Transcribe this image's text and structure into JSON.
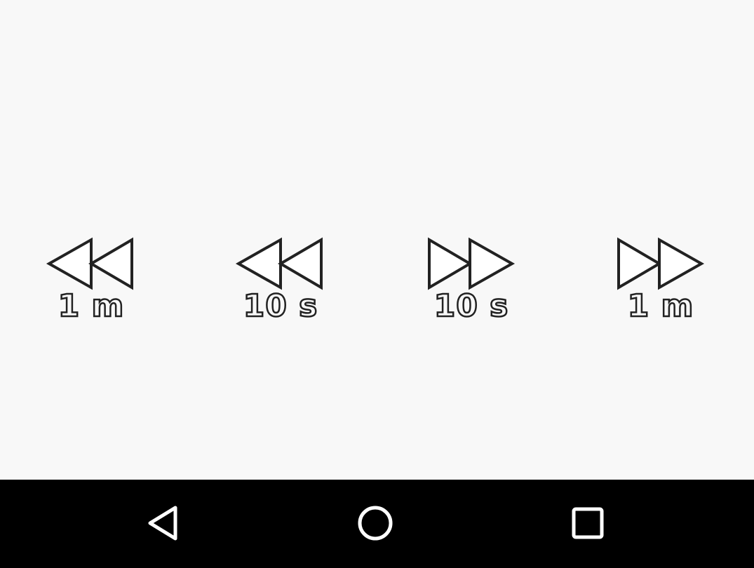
{
  "player_controls": {
    "rewind_1m": {
      "label": "1 m",
      "icon": "rewind-icon"
    },
    "rewind_10s": {
      "label": "10 s",
      "icon": "rewind-icon"
    },
    "forward_10s": {
      "label": "10 s",
      "icon": "fast-forward-icon"
    },
    "forward_1m": {
      "label": "1 m",
      "icon": "fast-forward-icon"
    }
  },
  "navigation_bar": {
    "buttons": [
      {
        "name": "back",
        "icon": "back-triangle-icon"
      },
      {
        "name": "home",
        "icon": "home-circle-icon"
      },
      {
        "name": "recents",
        "icon": "recents-square-icon"
      }
    ]
  },
  "colors": {
    "background": "#f8f8f8",
    "icon_stroke": "#222222",
    "navbar": "#000000",
    "navbar_icons": "#ffffff"
  }
}
